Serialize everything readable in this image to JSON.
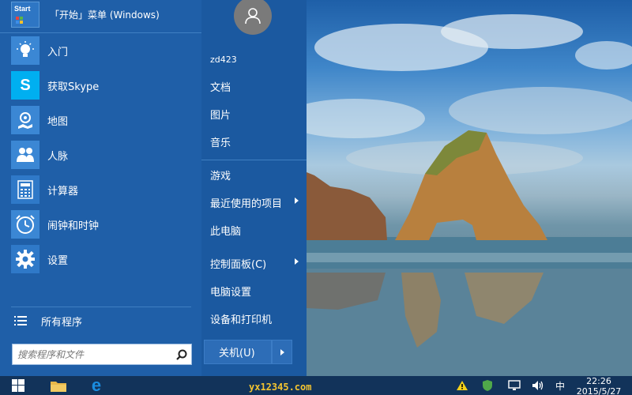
{
  "start_menu": {
    "header": {
      "tile_text": "Start",
      "title": "「开始」菜单 (Windows)"
    },
    "apps": [
      {
        "label": "入门",
        "icon": "lightbulb-icon"
      },
      {
        "label": "获取Skype",
        "icon": "skype-icon"
      },
      {
        "label": "地图",
        "icon": "maps-icon"
      },
      {
        "label": "人脉",
        "icon": "people-icon"
      },
      {
        "label": "计算器",
        "icon": "calculator-icon"
      },
      {
        "label": "闹钟和时钟",
        "icon": "alarm-clock-icon"
      },
      {
        "label": "设置",
        "icon": "gear-icon"
      }
    ],
    "all_programs": "所有程序",
    "search": {
      "placeholder": "搜索程序和文件",
      "value": ""
    },
    "user": {
      "name": "zd423"
    },
    "places": [
      {
        "label": "文档",
        "has_submenu": false
      },
      {
        "label": "图片",
        "has_submenu": false
      },
      {
        "label": "音乐",
        "has_submenu": false
      },
      {
        "label": "游戏",
        "has_submenu": false
      },
      {
        "label": "最近使用的项目",
        "has_submenu": true
      },
      {
        "label": "此电脑",
        "has_submenu": false
      },
      {
        "label": "控制面板(C)",
        "has_submenu": true
      },
      {
        "label": "电脑设置",
        "has_submenu": false
      },
      {
        "label": "设备和打印机",
        "has_submenu": false
      }
    ],
    "power_button": "关机(U)"
  },
  "taskbar": {
    "watermark": "yx12345.com",
    "ime": "中",
    "clock_time": "22:26",
    "clock_date": "2015/5/27"
  },
  "colors": {
    "menu_bg": "#1f5fa8",
    "tile_blue": "#3b87d4",
    "taskbar_bg": "#12335a"
  }
}
